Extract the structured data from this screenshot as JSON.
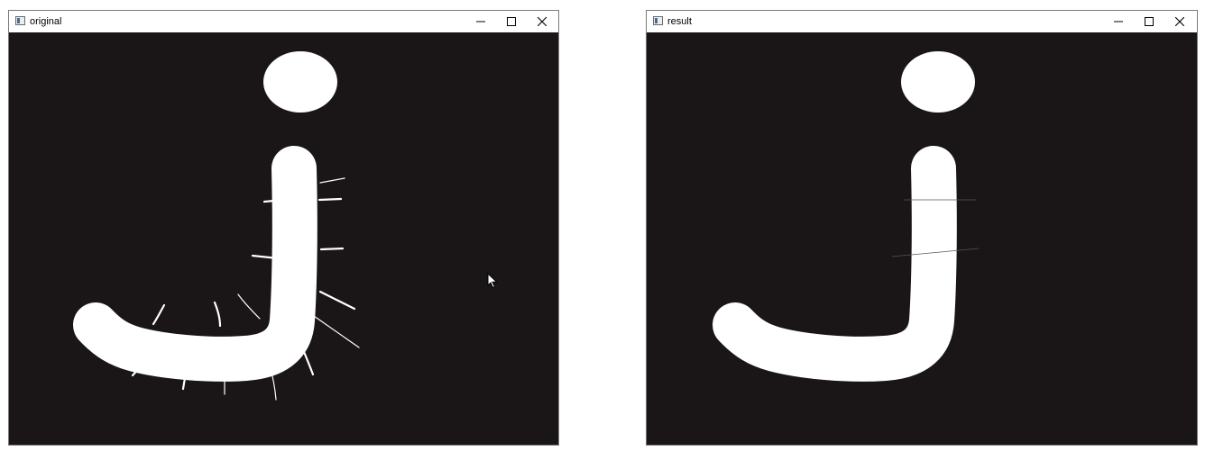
{
  "windows": {
    "original": {
      "title": "original",
      "icons": {
        "app": "app-window-icon",
        "minimize": "minimize-icon",
        "maximize": "maximize-icon",
        "close": "close-icon"
      }
    },
    "result": {
      "title": "result",
      "icons": {
        "app": "app-window-icon",
        "minimize": "minimize-icon",
        "maximize": "maximize-icon",
        "close": "close-icon"
      }
    }
  },
  "cursor": {
    "icon": "mouse-pointer-icon"
  },
  "colors": {
    "canvas_bg": "#1a1617",
    "glyph": "#ffffff",
    "titlebar": "#ffffff",
    "border": "#7a7a7a"
  }
}
